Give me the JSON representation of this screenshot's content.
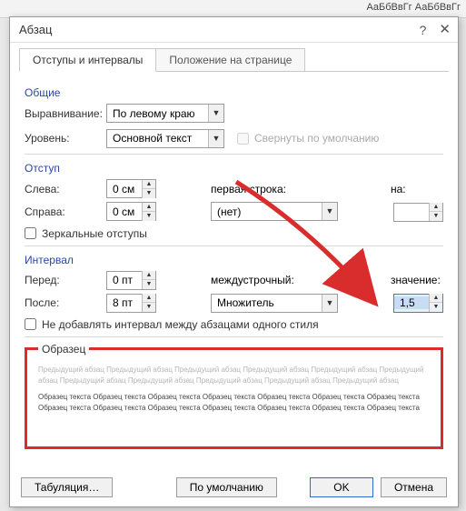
{
  "bg": {
    "styles": "АаБбВвГг  АаБбВвГг"
  },
  "dialog": {
    "title": "Абзац",
    "tabs": {
      "active": "Отступы и интервалы",
      "inactive": "Положение на странице"
    },
    "general": {
      "title": "Общие",
      "alignment_label": "Выравнивание:",
      "alignment_value": "По левому краю",
      "level_label": "Уровень:",
      "level_value": "Основной текст",
      "collapse_label": "Свернуты по умолчанию"
    },
    "indent": {
      "title": "Отступ",
      "left_label": "Слева:",
      "left_value": "0 см",
      "right_label": "Справа:",
      "right_value": "0 см",
      "first_label": "первая строка:",
      "first_value": "(нет)",
      "by_label": "на:",
      "by_value": "",
      "mirror_label": "Зеркальные отступы"
    },
    "spacing": {
      "title": "Интервал",
      "before_label": "Перед:",
      "before_value": "0 пт",
      "after_label": "После:",
      "after_value": "8 пт",
      "line_label": "междустрочный:",
      "line_value": "Множитель",
      "at_label": "значение:",
      "at_value": "1,5",
      "noadd_label": "Не добавлять интервал между абзацами одного стиля"
    },
    "preview": {
      "title": "Образец",
      "light": "Предыдущий абзац Предыдущий абзац Предыдущий абзац Предыдущий абзац Предыдущий абзац Предыдущий абзац Предыдущий абзац Предыдущий абзац Предыдущий абзац Предыдущий абзац Предыдущий абзац",
      "dark": "Образец текста Образец текста Образец текста Образец текста Образец текста Образец текста Образец текста Образец текста Образец текста Образец текста Образец текста Образец текста Образец текста Образец текста"
    },
    "buttons": {
      "tabs": "Табуляция…",
      "default": "По умолчанию",
      "ok": "OK",
      "cancel": "Отмена"
    }
  }
}
